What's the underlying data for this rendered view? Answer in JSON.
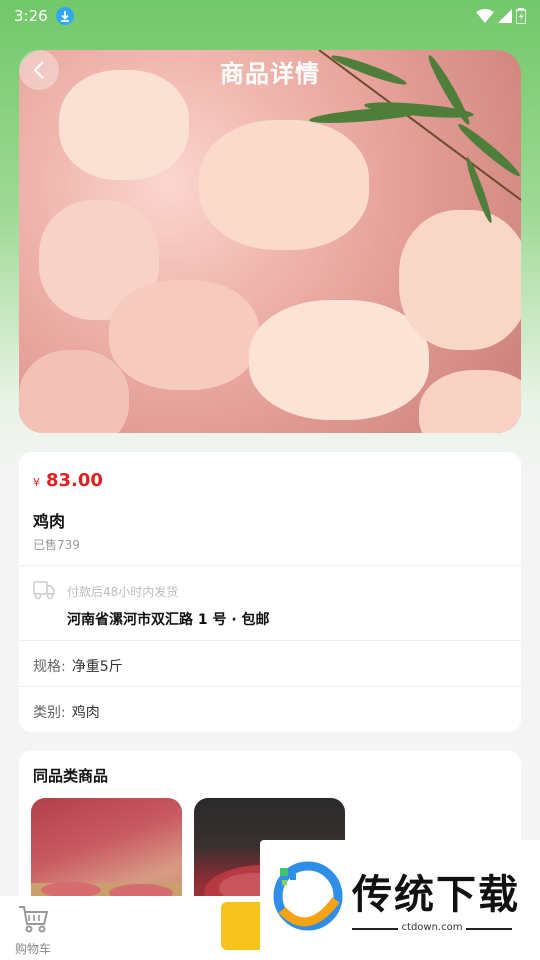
{
  "status_bar": {
    "time": "3:26"
  },
  "header": {
    "title": "商品详情"
  },
  "product": {
    "currency_symbol": "¥",
    "price": "83.00",
    "name": "鸡肉",
    "sold": "已售739",
    "shipping_note": "付款后48小时内发货",
    "shipping_address": "河南省漯河市双汇路 1 号 · 包邮",
    "spec_label": "规格:",
    "spec_value": "净重5斤",
    "category_label": "类别:",
    "category_value": "鸡肉"
  },
  "similar": {
    "title": "同品类商品"
  },
  "bottom_bar": {
    "cart_label": "购物车"
  },
  "watermark": {
    "title": "传统下载",
    "url": "ctdown.com"
  },
  "colors": {
    "accent_green": "#72c86a",
    "price_red": "#e02020",
    "buy_yellow": "#f6c21c"
  }
}
